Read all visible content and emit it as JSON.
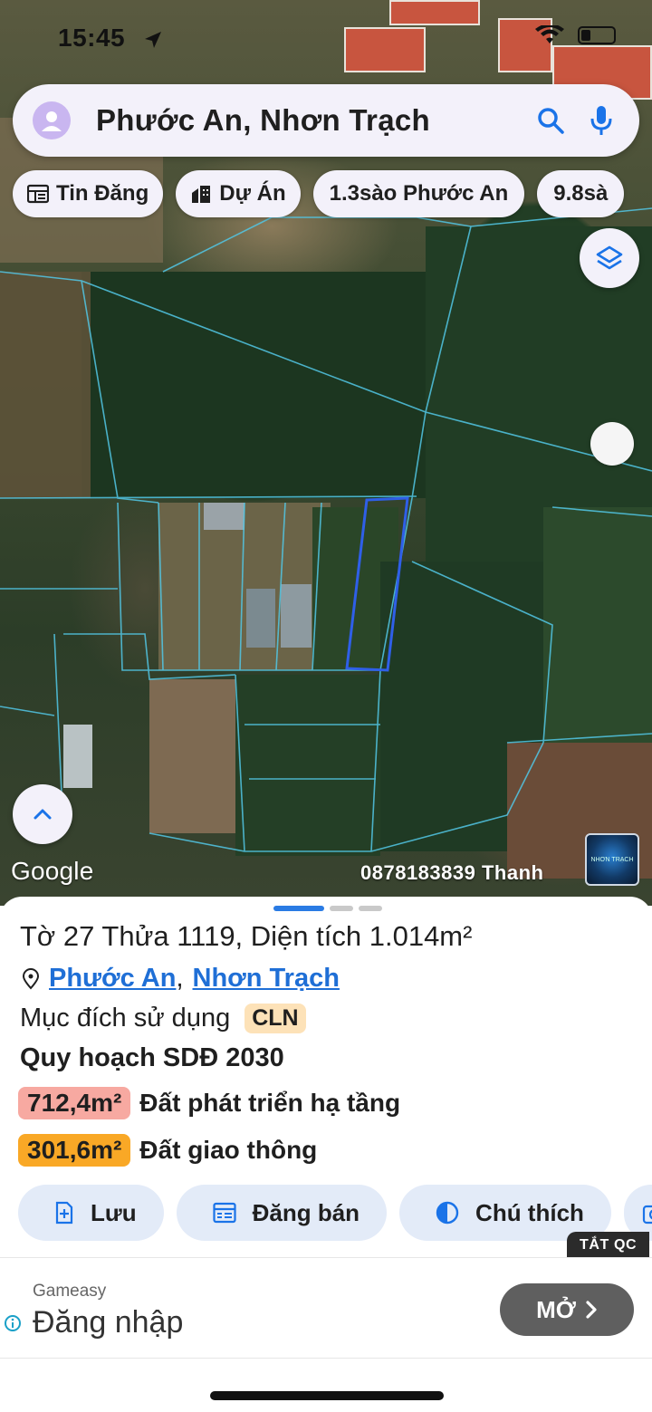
{
  "status_bar": {
    "time": "15:45"
  },
  "search": {
    "text": "Phước An, Nhơn Trạch"
  },
  "chips": [
    {
      "label": "Tin Đăng",
      "icon": "newspaper-icon"
    },
    {
      "label": "Dự Án",
      "icon": "buildings-icon"
    },
    {
      "label": "1.3sào Phước An",
      "icon": ""
    },
    {
      "label": "9.8sà",
      "icon": ""
    }
  ],
  "map": {
    "attribution": "Google",
    "watermark": "0878183839 Thanh",
    "mini_map_label": "NHƠN TRẠCH"
  },
  "sheet": {
    "parcel_title": "Tờ 27 Thửa 1119, Diện tích 1.014m²",
    "ward": "Phước An",
    "separator": ",",
    "district": "Nhơn Trạch",
    "purpose_label": "Mục đích sử dụng",
    "purpose_code": "CLN",
    "plan_title": "Quy hoạch SDĐ 2030",
    "plan_items": [
      {
        "area": "712,4m²",
        "label": "Đất phát triển hạ tầng",
        "color": "#f7a9a1"
      },
      {
        "area": "301,6m²",
        "label": "Đất giao thông",
        "color": "#f9a826"
      }
    ],
    "actions": [
      {
        "label": "Lưu",
        "icon": "bookmark-plus-icon"
      },
      {
        "label": "Đăng bán",
        "icon": "calendar-list-icon"
      },
      {
        "label": "Chú thích",
        "icon": "half-circle-icon"
      },
      {
        "label": "",
        "icon": "camera-icon"
      }
    ]
  },
  "ad": {
    "close_label": "TẮT QC",
    "brand": "Gameasy",
    "headline": "Đăng nhập",
    "cta": "MỞ"
  },
  "colors": {
    "accent": "#2a7be4",
    "link": "#1f6fd6",
    "chip_bg": "#f3f1fa",
    "action_bg": "#e3ebf8"
  }
}
